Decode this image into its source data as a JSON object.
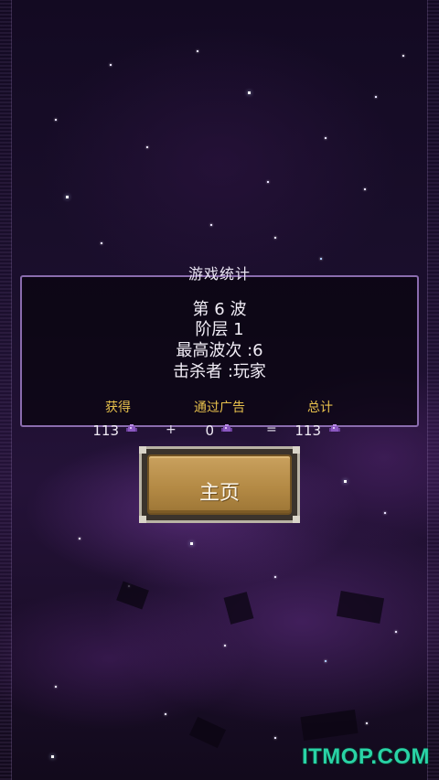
{
  "stats": {
    "title": "游戏统计",
    "wave": "第 6 波",
    "floor": "阶层 1",
    "highest_wave": "最高波次 :6",
    "killer": "击杀者 :玩家"
  },
  "rewards": {
    "earned_label": "获得",
    "ad_label": "通过广告",
    "total_label": "总计",
    "earned_value": "113",
    "ad_value": "0",
    "total_value": "113",
    "plus": "+",
    "equals": "=",
    "icon": "purple-crystal-icon"
  },
  "home_button": {
    "label": "主页"
  },
  "watermark": "ITMOP.COM",
  "colors": {
    "header_gold": "#e7c04c",
    "panel_border": "#8a6cae",
    "button_gold": "#b48a45",
    "watermark_green": "#29d3a6"
  }
}
